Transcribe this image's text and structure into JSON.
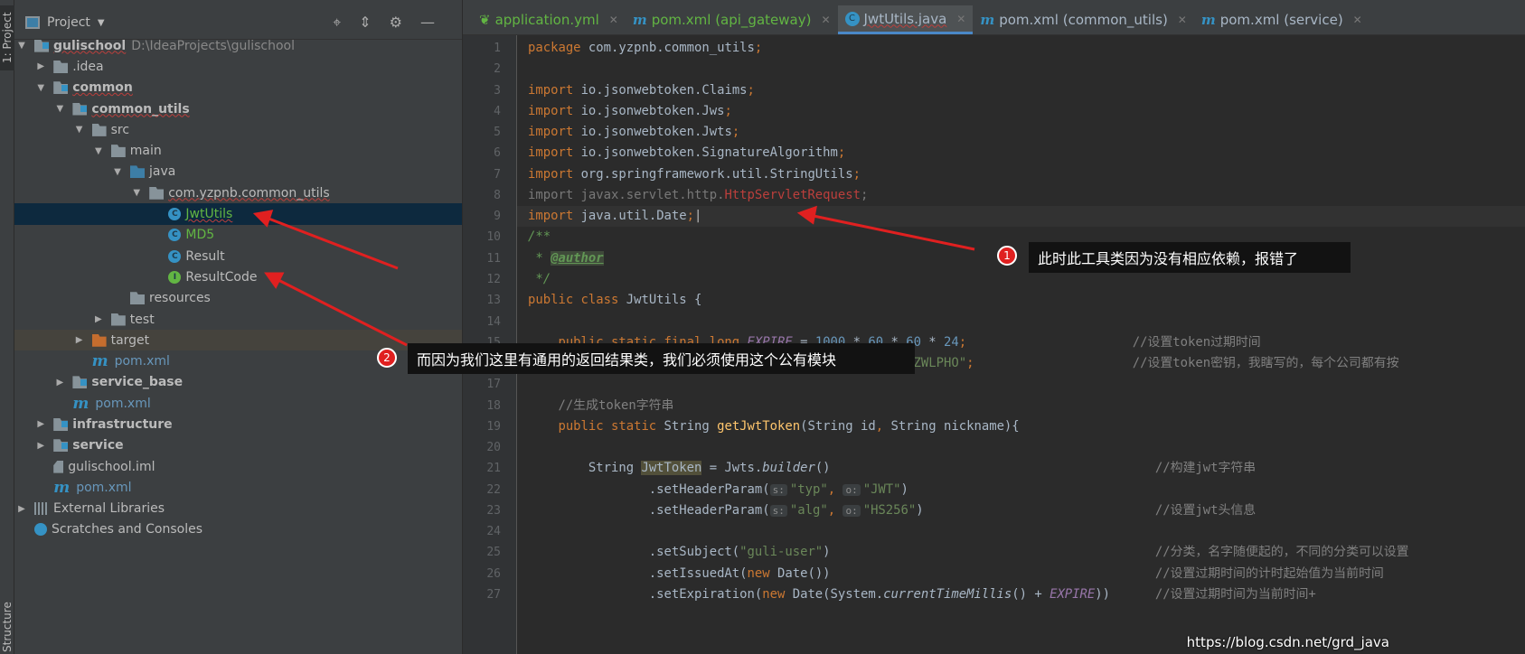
{
  "stripe": {
    "project_tab": "1: Project",
    "structure_tab": "Structure"
  },
  "project_panel": {
    "title": "Project",
    "icons": [
      "locate-icon",
      "collapse-icon",
      "gear-icon",
      "minimize-icon"
    ],
    "tree": [
      {
        "label": "gulischool",
        "extra": "D:\\IdeaProjects\\gulischool",
        "level": 0,
        "arrow": "down",
        "icon": "module",
        "bold": true,
        "squiggle": true
      },
      {
        "label": ".idea",
        "level": 1,
        "arrow": "right",
        "icon": "folder"
      },
      {
        "label": "common",
        "level": 1,
        "arrow": "down",
        "icon": "module",
        "bold": true,
        "squiggle": true
      },
      {
        "label": "common_utils",
        "level": 2,
        "arrow": "down",
        "icon": "module",
        "bold": true,
        "squiggle": true
      },
      {
        "label": "src",
        "level": 3,
        "arrow": "down",
        "icon": "folder"
      },
      {
        "label": "main",
        "level": 4,
        "arrow": "down",
        "icon": "folder"
      },
      {
        "label": "java",
        "level": 5,
        "arrow": "down",
        "icon": "src"
      },
      {
        "label": "com.yzpnb.common_utils",
        "level": 6,
        "arrow": "down",
        "icon": "package",
        "squiggle": true
      },
      {
        "label": "JwtUtils",
        "level": 7,
        "icon": "cls",
        "color": "green",
        "squiggle": true,
        "selected": true
      },
      {
        "label": "MD5",
        "level": 7,
        "icon": "cls",
        "color": "green"
      },
      {
        "label": "Result",
        "level": 7,
        "icon": "cls"
      },
      {
        "label": "ResultCode",
        "level": 7,
        "icon": "itf"
      },
      {
        "label": "resources",
        "level": 5,
        "icon": "folder"
      },
      {
        "label": "test",
        "level": 4,
        "arrow": "right",
        "icon": "folder"
      },
      {
        "label": "target",
        "level": 3,
        "arrow": "right",
        "icon": "target",
        "target": true
      },
      {
        "label": "pom.xml",
        "level": 3,
        "icon": "maven",
        "color": "blue"
      },
      {
        "label": "service_base",
        "level": 2,
        "arrow": "right",
        "icon": "module",
        "bold": true
      },
      {
        "label": "pom.xml",
        "level": 2,
        "icon": "maven",
        "color": "blue"
      },
      {
        "label": "infrastructure",
        "level": 1,
        "arrow": "right",
        "icon": "module",
        "bold": true
      },
      {
        "label": "service",
        "level": 1,
        "arrow": "right",
        "icon": "module",
        "bold": true
      },
      {
        "label": "gulischool.iml",
        "level": 1,
        "icon": "iml"
      },
      {
        "label": "pom.xml",
        "level": 1,
        "icon": "maven",
        "color": "blue"
      },
      {
        "label": "External Libraries",
        "level": 0,
        "arrow": "right",
        "icon": "libs"
      },
      {
        "label": "Scratches and Consoles",
        "level": 0,
        "icon": "scratch"
      }
    ]
  },
  "tabs": [
    {
      "label": "application.yml",
      "icon": "spring-icon",
      "green": true
    },
    {
      "label": "pom.xml (api_gateway)",
      "icon": "maven-icon",
      "green": true
    },
    {
      "label": "JwtUtils.java",
      "icon": "class-icon",
      "active": true
    },
    {
      "label": "pom.xml (common_utils)",
      "icon": "maven-icon"
    },
    {
      "label": "pom.xml (service)",
      "icon": "maven-icon"
    }
  ],
  "editor": {
    "current_line": 9,
    "lines": [
      [
        [
          "k",
          "package"
        ],
        [
          "",
          "com.yzpnb.common_utils"
        ],
        [
          "k",
          ";"
        ]
      ],
      [],
      [
        [
          "k",
          "import"
        ],
        [
          "",
          "io.jsonwebtoken.Claims"
        ],
        [
          "k",
          ";"
        ]
      ],
      [
        [
          "k",
          "import"
        ],
        [
          "",
          "io.jsonwebtoken.Jws"
        ],
        [
          "k",
          ";"
        ]
      ],
      [
        [
          "k",
          "import"
        ],
        [
          "",
          "io.jsonwebtoken.Jwts"
        ],
        [
          "k",
          ";"
        ]
      ],
      [
        [
          "k",
          "import"
        ],
        [
          "",
          "io.jsonwebtoken.SignatureAlgorithm"
        ],
        [
          "k",
          ";"
        ]
      ],
      [
        [
          "k",
          "import"
        ],
        [
          "",
          "org.springframework.util.StringUtils"
        ],
        [
          "k",
          ";"
        ]
      ],
      [
        [
          "g",
          "import javax.servlet.http."
        ],
        [
          "r",
          "HttpServletRequest"
        ],
        [
          "g",
          ";"
        ]
      ],
      [
        [
          "k",
          "import"
        ],
        [
          "",
          "java.util.Date"
        ],
        [
          "k",
          ";"
        ]
      ],
      [
        [
          "doc",
          "/**"
        ]
      ],
      [
        [
          "doc",
          " * "
        ],
        [
          "tag",
          "@author"
        ]
      ],
      [
        [
          "doc",
          " */"
        ]
      ],
      [
        [
          "k",
          "public class"
        ],
        [
          "",
          "JwtUtils {"
        ]
      ],
      [],
      [
        [
          "",
          "    "
        ],
        [
          "k",
          "public static final long"
        ],
        [
          "f",
          "EXPIRE"
        ],
        [
          "",
          " = "
        ],
        [
          "n",
          "1000"
        ],
        [
          "",
          " * "
        ],
        [
          "n",
          "60"
        ],
        [
          "",
          " * "
        ],
        [
          "n",
          "60"
        ],
        [
          "",
          " * "
        ],
        [
          "n",
          "24"
        ],
        [
          "k",
          ";"
        ],
        [
          "cmt80",
          "//设置token过期时间"
        ]
      ],
      [
        [
          "",
          "                                "
        ],
        [
          "s",
          "DbRigUDaY6pZFfWus2jZWLPHO\""
        ],
        [
          "k",
          ";"
        ],
        [
          "cmt80",
          "//设置token密钥，我瞎写的，每个公司都有按"
        ]
      ],
      [],
      [
        [
          "c",
          "    //生成token字符串"
        ]
      ],
      [
        [
          "",
          "    "
        ],
        [
          "k",
          "public static"
        ],
        [
          "",
          "String "
        ],
        [
          "m",
          "getJwtToken"
        ],
        [
          "",
          "(String id"
        ],
        [
          "k",
          ","
        ],
        [
          "",
          "String nickname){"
        ]
      ],
      [],
      [
        [
          "",
          "        String "
        ],
        [
          "hl",
          "JwtToken"
        ],
        [
          "",
          " = Jwts."
        ],
        [
          "it",
          "builder"
        ],
        [
          "",
          "()"
        ],
        [
          "cmt83",
          "//构建jwt字符串"
        ]
      ],
      [
        [
          "",
          "                .setHeaderParam("
        ],
        [
          "hint",
          "s:"
        ],
        [
          "s",
          "\"typ\""
        ],
        [
          "k",
          ","
        ],
        [
          " ",
          ""
        ],
        [
          "hint",
          "o:"
        ],
        [
          "s",
          "\"JWT\""
        ],
        [
          "",
          ")"
        ]
      ],
      [
        [
          "",
          "                .setHeaderParam("
        ],
        [
          "hint",
          "s:"
        ],
        [
          "s",
          "\"alg\""
        ],
        [
          "k",
          ","
        ],
        [
          " ",
          ""
        ],
        [
          "hint",
          "o:"
        ],
        [
          "s",
          "\"HS256\""
        ],
        [
          "",
          ")"
        ],
        [
          "cmt83",
          "//设置jwt头信息"
        ]
      ],
      [],
      [
        [
          "",
          "                .setSubject("
        ],
        [
          "s",
          "\"guli-user\""
        ],
        [
          "",
          ")"
        ],
        [
          "cmt83",
          "//分类，名字随便起的，不同的分类可以设置"
        ]
      ],
      [
        [
          "",
          "                .setIssuedAt("
        ],
        [
          "k",
          "new"
        ],
        [
          "",
          "Date())"
        ],
        [
          "cmt83",
          "//设置过期时间的计时起始值为当前时间"
        ]
      ],
      [
        [
          "",
          "                .setExpiration("
        ],
        [
          "k",
          "new"
        ],
        [
          "",
          "Date(System."
        ],
        [
          "it",
          "currentTimeMillis"
        ],
        [
          "",
          "() + "
        ],
        [
          "f",
          "EXPIRE"
        ],
        [
          "",
          "))"
        ],
        [
          "cmt83",
          "//设置过期时间为当前时间+"
        ]
      ]
    ]
  },
  "annotations": [
    {
      "number": "1",
      "text": "此时此工具类因为没有相应依赖，报错了"
    },
    {
      "number": "2",
      "text": "而因为我们这里有通用的返回结果类，我们必须使用这个公有模块"
    }
  ],
  "watermark": "https://blog.csdn.net/grd_java",
  "colors": {
    "keyword": "#cc7832",
    "string": "#6a8759",
    "number": "#6897bb",
    "comment": "#808080",
    "annotation_red": "#e02020",
    "selection": "#0d293e"
  }
}
